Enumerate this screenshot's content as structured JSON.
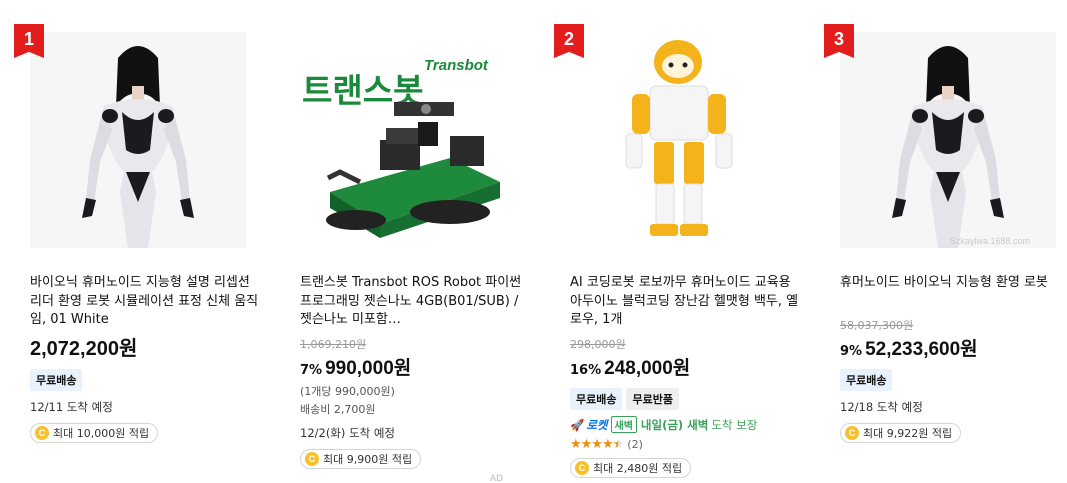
{
  "products": [
    {
      "rank": "1",
      "title": "바이오닉 휴머노이드 지능형 설명 리셉션 리더 환영 로봇 시뮬레이션 표정 신체 움직임, 01 White",
      "price": "2,072,200원",
      "badge": "무료배송",
      "arrival": "12/11 도착 예정",
      "reward": "최대 10,000원 적립"
    },
    {
      "title": "트랜스봇 Transbot ROS Robot 파이썬 프로그래밍 젯슨나노 4GB(B01/SUB) / 젯슨나노 미포함…",
      "original_price": "1,069,210원",
      "discount": "7%",
      "price": "990,000원",
      "unit_price": "(1개당 990,000원)",
      "shipping": "배송비 2,700원",
      "arrival": "12/2(화) 도착 예정",
      "reward": "최대 9,900원 적립",
      "image_text": {
        "logo": "Transbot",
        "korean": "트랜스봇"
      }
    },
    {
      "rank": "2",
      "title": "AI 코딩로봇 로보까무 휴머노이드 교육용 아두이노 블럭코딩 장난감 헬맷형 백두, 옐로우, 1개",
      "original_price": "298,000원",
      "discount": "16%",
      "price": "248,000원",
      "badges": [
        "무료배송",
        "무료반품"
      ],
      "rocket": {
        "label": "로켓",
        "dawn": "새벽",
        "delivery": "내일(금) 새벽",
        "suffix": "도착 보장"
      },
      "rating": 4.5,
      "review_count": "(2)",
      "reward": "최대 2,480원 적립"
    },
    {
      "rank": "3",
      "title": "휴머노이드 바이오닉 지능형 환영 로봇",
      "original_price": "58,037,300원",
      "discount": "9%",
      "price": "52,233,600원",
      "badge": "무료배송",
      "arrival": "12/18 도착 예정",
      "reward": "최대 9,922원 적립",
      "watermark": "Szkaylwa.1688.com"
    }
  ],
  "ad_label": "AD",
  "colors": {
    "rank_red": "#e31c1c",
    "badge_blue": "#e7f2fc",
    "rocket_blue": "#0073e9",
    "dawn_green": "#38a35c",
    "star_orange": "#f28b0c"
  }
}
